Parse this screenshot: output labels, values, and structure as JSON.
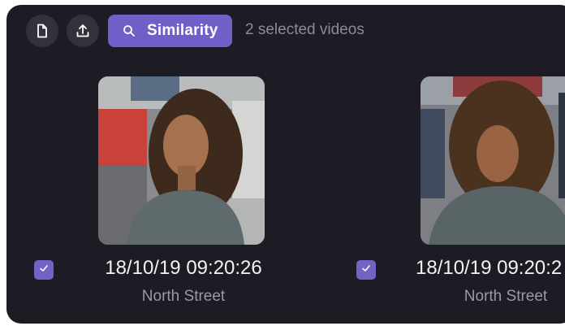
{
  "toolbar": {
    "new_icon": "document-icon",
    "upload_icon": "upload-icon",
    "similarity_label": "Similarity",
    "similarity_icon": "search-icon",
    "selected_text": "2 selected videos"
  },
  "results": [
    {
      "timestamp": "18/10/19 09:20:26",
      "location": "North Street",
      "selected": true
    },
    {
      "timestamp": "18/10/19 09:20:2",
      "location": "North Street",
      "selected": true
    }
  ],
  "colors": {
    "panel_bg": "#1d1c25",
    "accent": "#6f5fc6",
    "button_bg": "#33323c",
    "muted_text": "#8c8b97"
  }
}
